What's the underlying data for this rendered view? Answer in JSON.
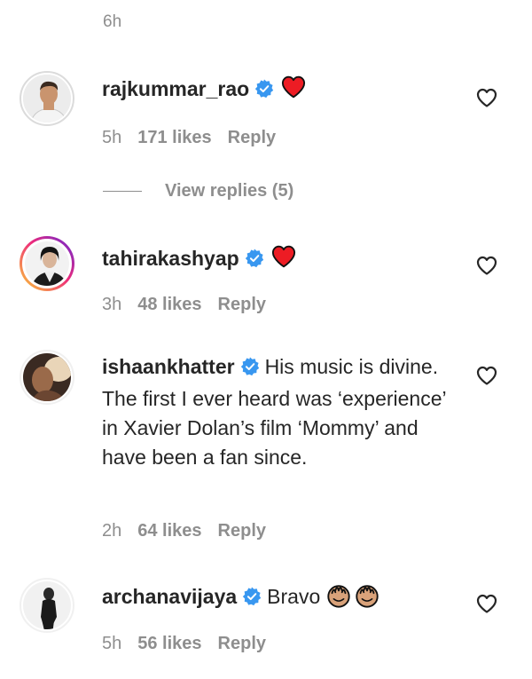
{
  "header": {
    "time": "6h"
  },
  "comments": [
    {
      "username": "rajkummar_rao",
      "verified": true,
      "text": "",
      "emoji": "red-heart",
      "time": "5h",
      "likes": "171 likes",
      "reply": "Reply",
      "view_replies": "View replies (5)"
    },
    {
      "username": "tahirakashyap",
      "verified": true,
      "text": "",
      "emoji": "red-heart",
      "time": "3h",
      "likes": "48 likes",
      "reply": "Reply"
    },
    {
      "username": "ishaankhatter",
      "verified": true,
      "text": "His music is divine. The first I ever heard was ‘experience’ in Xavier Dolan’s film ‘Mommy’ and have been a fan since.",
      "time": "2h",
      "likes": "64 likes",
      "reply": "Reply"
    },
    {
      "username": "archanavijaya",
      "verified": true,
      "text": "Bravo",
      "emoji": "clapping-hands x2",
      "time": "5h",
      "likes": "56 likes",
      "reply": "Reply"
    }
  ],
  "colors": {
    "text": "#262626",
    "secondary": "#8e8e8e",
    "verified": "#3897f0",
    "heart": "#ed1c24"
  }
}
